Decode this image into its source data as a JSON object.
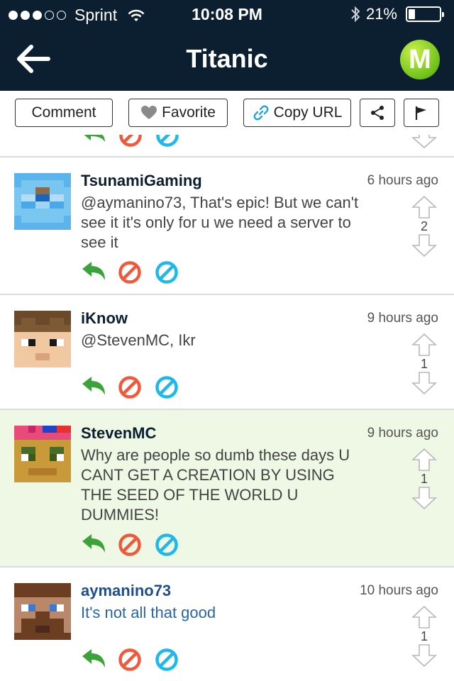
{
  "status_bar": {
    "carrier": "Sprint",
    "time": "10:08 PM",
    "battery_percent": "21%",
    "battery_level": 0.21,
    "signal_bars_filled": 3,
    "signal_bars_total": 5
  },
  "nav": {
    "title": "Titanic",
    "back_icon": "back-arrow-icon",
    "logo_letter": "M"
  },
  "actions": {
    "comment": "Comment",
    "favorite": "Favorite",
    "copy_url": "Copy URL",
    "share_icon": "share-icon",
    "flag_icon": "flag-icon"
  },
  "colors": {
    "header_bg": "#0c1f30",
    "reply_green": "#3aa33a",
    "block_red": "#f05a3a",
    "hide_blue": "#1fb8ea",
    "highlight_bg": "#eef8e4"
  },
  "comments": [
    {
      "username": "TsunamiGaming",
      "time": "6 hours ago",
      "text": "@aymanino73, That's epic! But we can't see it it's only for u we need a server to see it",
      "votes": "2"
    },
    {
      "username": "iKnow",
      "time": "9 hours ago",
      "text": "@StevenMC, Ikr",
      "votes": "1"
    },
    {
      "username": "StevenMC",
      "time": "9 hours ago",
      "text": "Why are people so dumb these days U CANT GET A CREATION BY USING THE SEED OF THE WORLD U DUMMIES!",
      "votes": "1"
    },
    {
      "username": "aymanino73",
      "time": "10 hours ago",
      "text": "It's not all that good",
      "votes": "1"
    }
  ]
}
